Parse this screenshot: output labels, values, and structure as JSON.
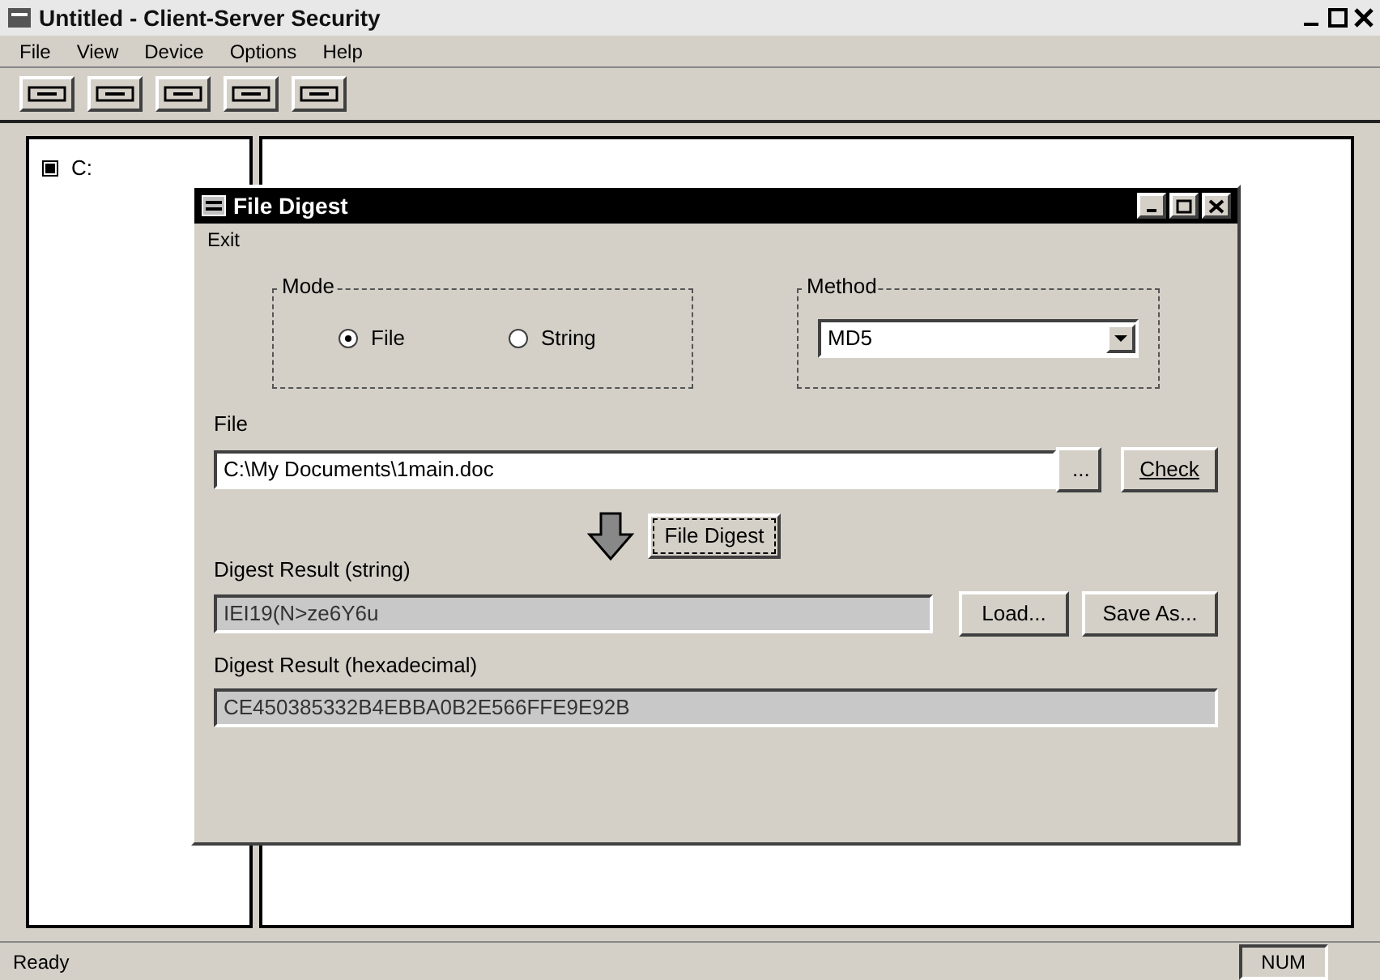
{
  "window": {
    "title": "Untitled - Client-Server Security"
  },
  "menu": [
    "File",
    "View",
    "Device",
    "Options",
    "Help"
  ],
  "tree": {
    "items": [
      {
        "label": "C:",
        "expanded": false
      }
    ]
  },
  "dialog": {
    "title": "File Digest",
    "menu": [
      "Exit"
    ],
    "mode": {
      "label": "Mode",
      "options": [
        {
          "label": "File",
          "selected": true
        },
        {
          "label": "String",
          "selected": false
        }
      ]
    },
    "method": {
      "label": "Method",
      "value": "MD5"
    },
    "file": {
      "label": "File",
      "value": "C:\\My Documents\\1main.doc",
      "browse": "...",
      "check": "Check"
    },
    "digest_button": "File Digest",
    "string_result": {
      "label": "Digest Result (string)",
      "value": "IEI19(N>ze6Y6u",
      "load": "Load...",
      "save": "Save As..."
    },
    "hex_result": {
      "label": "Digest Result (hexadecimal)",
      "value": "CE450385332B4EBBA0B2E566FFE9E92B"
    }
  },
  "status_bar": {
    "text": "Ready",
    "num": "NUM"
  }
}
